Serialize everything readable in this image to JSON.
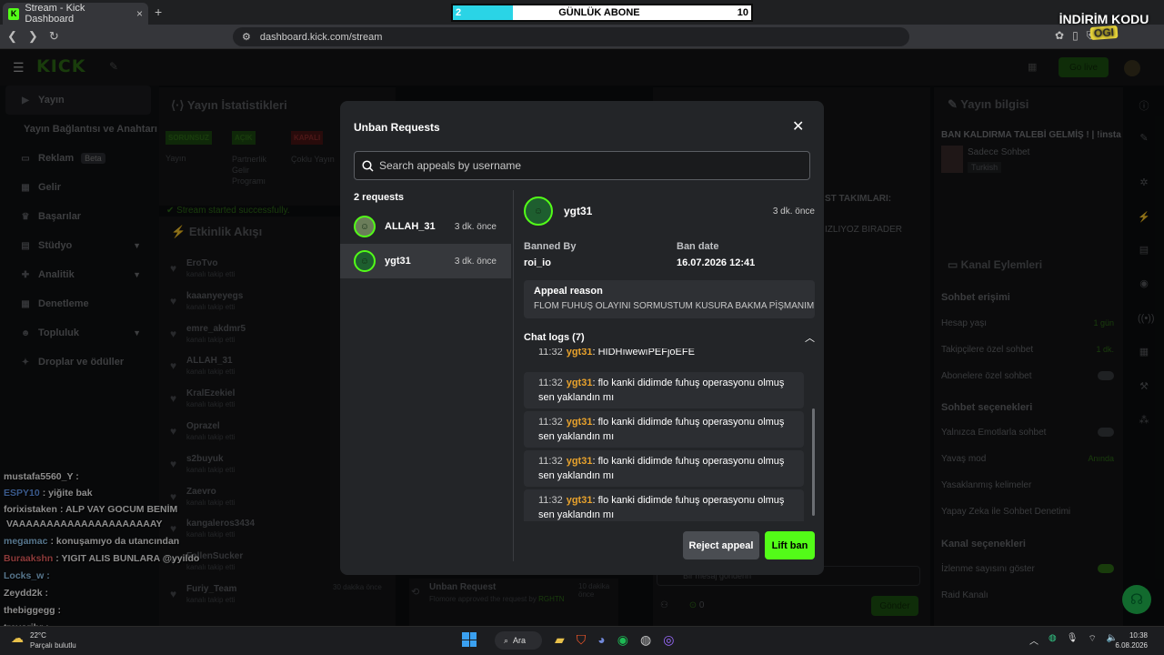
{
  "browser": {
    "tab_title": "Stream - Kick Dashboard",
    "tab_icon": "K",
    "new_tab": "+",
    "tab_close": "×",
    "url": "dashboard.kick.com/stream"
  },
  "overlay": {
    "sub_bar": {
      "current": "2",
      "title": "GÜNLÜK ABONE",
      "goal": "10",
      "progress": 0.2
    },
    "promo_line1": "İNDİRİM KODU",
    "promo_code": "OGI"
  },
  "kick": {
    "logo": "KICK",
    "go_live": "Go live"
  },
  "sidebar": {
    "items": [
      {
        "label": "Yayın",
        "icon": "▶"
      },
      {
        "label": "Yayın Bağlantısı ve Anahtarı",
        "icon": ""
      },
      {
        "label": "Reklam",
        "icon": "▭",
        "badge": "Beta"
      },
      {
        "label": "Gelir",
        "icon": "▦"
      },
      {
        "label": "Başarılar",
        "icon": "♛"
      },
      {
        "label": "Stüdyo",
        "icon": "▤"
      },
      {
        "label": "Analitik",
        "icon": "✚"
      },
      {
        "label": "Denetleme",
        "icon": "▦"
      },
      {
        "label": "Topluluk",
        "icon": "☻"
      },
      {
        "label": "Droplar ve ödüller",
        "icon": "✦"
      }
    ]
  },
  "main": {
    "stats_title": "Yayın İstatistikleri",
    "badges": [
      "SORUNSUZ",
      "AÇIK",
      "KAPALI"
    ],
    "badge_labels": [
      "Yayın",
      "Partnerlik Gelir Programı",
      "Çoklu Yayın"
    ],
    "started": "Stream started successfully.",
    "feed_title": "Etkinlik Akışı",
    "feed": [
      {
        "name": "EroTvo",
        "sub": "kanalı takip etti"
      },
      {
        "name": "kaaanyeyegs",
        "sub": "kanalı takip etti"
      },
      {
        "name": "emre_akdmr5",
        "sub": "kanalı takip etti"
      },
      {
        "name": "ALLAH_31",
        "sub": "kanalı takip etti"
      },
      {
        "name": "KralEzekiel",
        "sub": "kanalı takip etti"
      },
      {
        "name": "Oprazel",
        "sub": "kanalı takip etti"
      },
      {
        "name": "s2buyuk",
        "sub": "kanalı takip etti"
      },
      {
        "name": "Zaevro",
        "sub": "kanalı takip etti"
      },
      {
        "name": "kangaleros3434",
        "sub": "kanalı takip etti"
      },
      {
        "name": "FallenSucker",
        "sub": "kanalı takip etti"
      },
      {
        "name": "Furiy_Team",
        "sub": "kanalı takip etti"
      }
    ],
    "unban_feed": {
      "title": "Unban Request",
      "detail": "Flomore approved the request by",
      "who": "RGHTN",
      "time": "10 dakika önce"
    },
    "other_time": "30 dakika önce",
    "chat_placeholder": "Bir mesaj gönderin",
    "chat_count": "0",
    "send": "Gönder",
    "chat_snippet1": "ST TAKIMLARI:",
    "chat_snippet2": "IZLIYOZ BIRADER"
  },
  "right": {
    "info_title": "Yayın bilgisi",
    "stream_title": "BAN KALDIRMA TALEBİ GELMİŞ ! | !insta",
    "category": "Sadece Sohbet",
    "language": "Turkish",
    "actions_title": "Kanal Eylemleri",
    "chat_access": "Sohbet erişimi",
    "rows": [
      {
        "label": "Hesap yaşı",
        "value": "1 gün"
      },
      {
        "label": "Takipçilere özel sohbet",
        "value": "1 dk."
      },
      {
        "label": "Abonelere özel sohbet",
        "value": ""
      }
    ],
    "chat_options": "Sohbet seçenekleri",
    "rows2": [
      {
        "label": "Yalnızca Emotlarla sohbet",
        "value": ""
      },
      {
        "label": "Yavaş mod",
        "value": "Anında"
      },
      {
        "label": "Yasaklanmış kelimeler",
        "value": ""
      },
      {
        "label": "Yapay Zeka ile Sohbet Denetimi",
        "value": ""
      }
    ],
    "channel_options": "Kanal seçenekleri",
    "rows3": [
      {
        "label": "İzlenme sayısını göster",
        "value": ""
      },
      {
        "label": "Raid Kanalı",
        "value": ""
      }
    ]
  },
  "stream_chat": [
    {
      "user": "mustafa5560_Y :",
      "msg": "",
      "color": "#ffffff"
    },
    {
      "user": "ESPY10",
      "msg": ": yiğite bak",
      "color": "#6aa4ff"
    },
    {
      "user": "forixistaken",
      "msg": ": ALP VAY GOCUM BENİM",
      "color": "#ffffff"
    },
    {
      "user": "",
      "msg": "VAAAAAAAAAAAAAAAAAAAAAY",
      "color": "#ffffff"
    },
    {
      "user": "megamac",
      "msg": ": konuşamıyo da utancından",
      "color": "#9dd6ff"
    },
    {
      "user": "Buraakshn",
      "msg": ": YIGIT ALIS BUNLARA @yyildo",
      "color": "#ff6a6a"
    },
    {
      "user": "Locks_w :",
      "msg": "",
      "color": "#9dd6ff"
    },
    {
      "user": "Zeydd2k :",
      "msg": "",
      "color": "#ffffff"
    },
    {
      "user": "thebiggegg :",
      "msg": "",
      "color": "#ffffff"
    },
    {
      "user": "trevorjhr :",
      "msg": "",
      "color": "#ffffff"
    }
  ],
  "modal": {
    "title": "Unban Requests",
    "search_placeholder": "Search appeals by username",
    "request_count": "2 requests",
    "requests": [
      {
        "name": "ALLAH_31",
        "time": "3 dk. önce"
      },
      {
        "name": "ygt31",
        "time": "3 dk. önce"
      }
    ],
    "detail": {
      "name": "ygt31",
      "time": "3 dk. önce",
      "banned_by_label": "Banned By",
      "banned_by": "roi_io",
      "ban_date_label": "Ban date",
      "ban_date": "16.07.2026 12:41",
      "appeal_reason_label": "Appeal reason",
      "appeal_reason": "FLOM FUHUŞ OLAYINI SORMUSTUM KUSURA BAKMA PİŞMANIM",
      "chat_logs_label": "Chat logs (7)",
      "logs": [
        {
          "time": "11:32",
          "user": "ygt31",
          "msg": ": HIDHıwewıPEFjoEFE"
        },
        {
          "time": "11:32",
          "user": "ygt31",
          "msg": ": flo kanki didimde fuhuş operasyonu olmuş sen yaklandın mı"
        },
        {
          "time": "11:32",
          "user": "ygt31",
          "msg": ": flo kanki didimde fuhuş operasyonu olmuş sen yaklandın mı"
        },
        {
          "time": "11:32",
          "user": "ygt31",
          "msg": ": flo kanki didimde fuhuş operasyonu olmuş sen yaklandın mı"
        },
        {
          "time": "11:32",
          "user": "ygt31",
          "msg": ": flo kanki didimde fuhuş operasyonu olmuş sen yaklandın mı"
        }
      ]
    },
    "reject": "Reject appeal",
    "lift": "Lift ban"
  },
  "taskbar": {
    "weather_temp": "22°C",
    "weather": "Parçalı bulutlu",
    "search": "Ara",
    "time": "10:38",
    "date": "6.08.2026"
  }
}
